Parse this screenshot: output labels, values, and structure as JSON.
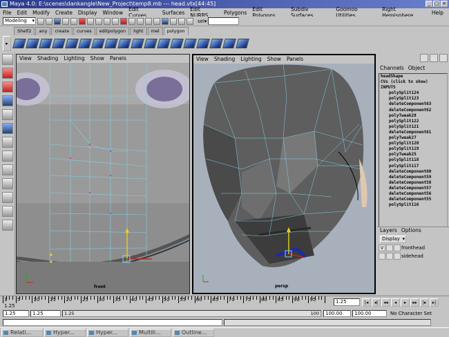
{
  "window": {
    "title": "Maya 4.0: E:\\scenes\\dankangle\\New_Project\\temp8.mb  ---  head.vtx[44:45]",
    "min": "_",
    "max": "□",
    "close": "×"
  },
  "menu": [
    "File",
    "Edit",
    "Modify",
    "Create",
    "Display",
    "Window",
    "Edit Curves",
    "Surfaces",
    "Edit NURBS",
    "Polygons",
    "Edit Polygons",
    "Subdiv Surfaces",
    "Goomoo Utilities",
    "Right Hemisphere",
    "Help"
  ],
  "status": {
    "mode": "Modeling",
    "sel_label": "sel▾"
  },
  "shelf": {
    "tabs": [
      "Shelf2",
      "any",
      "create",
      "curves",
      "editpolygon",
      "light",
      "mel",
      "polygon"
    ],
    "active_tab": 7,
    "arrow": "▸"
  },
  "viewports": {
    "front": {
      "menu": [
        "View",
        "Shading",
        "Lighting",
        "Show",
        "Panels"
      ],
      "label": "front"
    },
    "persp": {
      "menu": [
        "View",
        "Shading",
        "Lighting",
        "Show",
        "Panels"
      ],
      "label": "persp"
    }
  },
  "channel_box": {
    "menu": [
      "Channels",
      "Object"
    ],
    "rows": [
      "headShape",
      "CVs (click to show)",
      "INPUTS",
      "polySplit124",
      "polySplit123",
      "deleteComponent63",
      "deleteComponent62",
      "polyTweak28",
      "polySplit122",
      "polySplit121",
      "deleteComponent61",
      "polyTweak27",
      "polySplit120",
      "polySplit119",
      "polyTweak25",
      "polySplit118",
      "polySplit117",
      "deleteComponent60",
      "deleteComponent59",
      "deleteComponent58",
      "deleteComponent57",
      "deleteComponent56",
      "deleteComponent55",
      "polySplit116"
    ]
  },
  "layers": {
    "menu": [
      "Layers",
      "Options"
    ],
    "display": "Display",
    "items": [
      {
        "v": "V",
        "name": "fronthead"
      },
      {
        "v": "",
        "name": "sidehead"
      }
    ]
  },
  "time_slider": {
    "labels": [
      "1",
      "5",
      "10",
      "15",
      "20",
      "25",
      "30",
      "35",
      "40",
      "45",
      "50",
      "55",
      "60",
      "65",
      "70",
      "75",
      "80",
      "85",
      "90",
      "95"
    ],
    "current_marker": "1.25",
    "current_time": "1.25",
    "play_buttons": [
      "|◂",
      "◂|",
      "◂◂",
      "◂",
      "▸",
      "▸▸",
      "|▸",
      "▸|"
    ]
  },
  "range_slider": {
    "start": "1.25",
    "start2": "1.25",
    "bar_start": "1.25",
    "bar_end": "100",
    "end": "100.00",
    "end2": "100.00",
    "character_set": "No Character Set"
  },
  "taskbar": [
    "Relati...",
    "Hyper...",
    "Hyper...",
    "Multili...",
    "Outline..."
  ],
  "colors": {
    "title_start": "#2b3a8a",
    "title_end": "#6b7fcf",
    "wire": "#7fd4e8"
  }
}
